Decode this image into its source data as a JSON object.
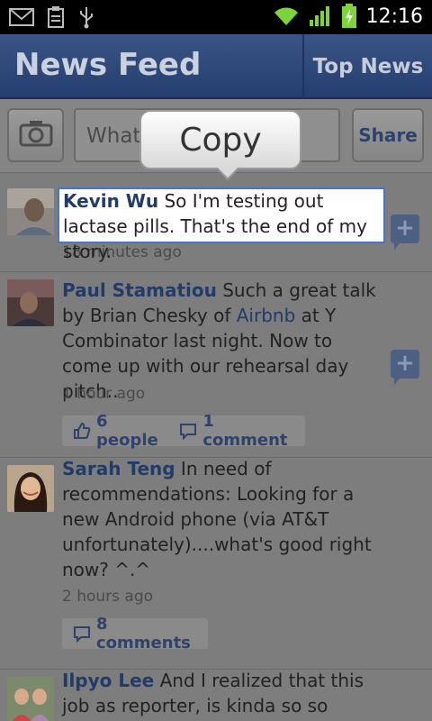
{
  "status_bar": {
    "left_icons": [
      "gmail-icon",
      "clipboard-icon",
      "usb-icon"
    ],
    "right_icons": [
      "wifi-icon",
      "signal-icon",
      "battery-charging-icon"
    ],
    "time": "12:16"
  },
  "header": {
    "title": "News Feed",
    "top_news_label": "Top News"
  },
  "composer": {
    "placeholder_visible": "What'",
    "share_label": "Share",
    "camera_icon": "camera-icon"
  },
  "popup": {
    "label": "Copy"
  },
  "stories": [
    {
      "name": "Kevin Wu",
      "text": " So I'm testing out lactase pills. That's the end of my story.",
      "time": "18 minutes ago"
    },
    {
      "name": "Paul Stamatiou",
      "text_before": " Such a great talk by Brian Chesky of ",
      "link": "Airbnb",
      "text_after": " at Y Combinator last night. Now to come up with our rehearsal day pitch..",
      "time": "1 hour ago",
      "likes": "6 people",
      "comments": "1 comment"
    },
    {
      "name": "Sarah Teng",
      "text": " In need of recommendations: Looking for a new Android phone (via AT&T unfortunately)....what's good right now? ^.^",
      "time": "2 hours ago",
      "comments": "8 comments"
    },
    {
      "name": "Ilpyo Lee",
      "text": " And I realized that this job as reporter, is kinda so so"
    }
  ],
  "colors": {
    "header_bg": "#2f4879",
    "name_color": "#233b67",
    "highlight_border": "#4a73c9",
    "feed_bg": "#7d7d7d"
  }
}
